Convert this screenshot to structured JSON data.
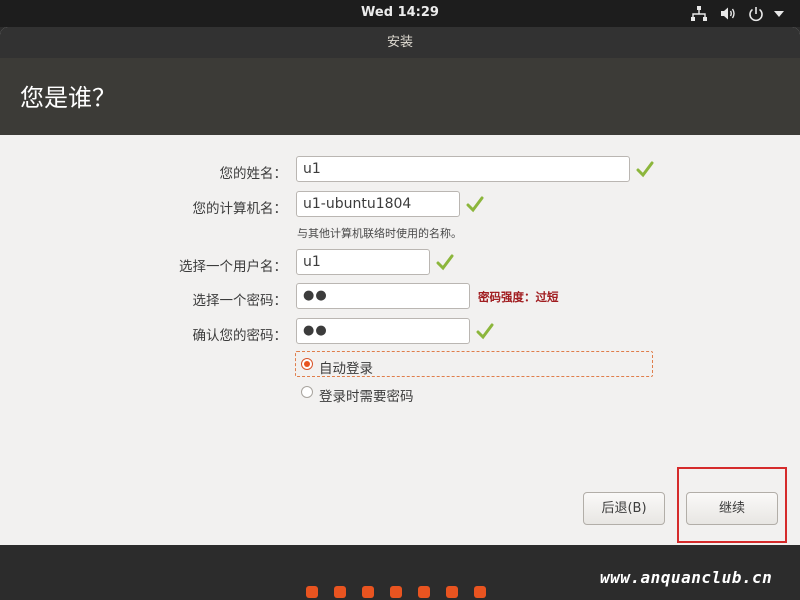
{
  "topbar": {
    "clock": "Wed 14:29",
    "icons": [
      "network-wired-icon",
      "volume-icon",
      "power-icon",
      "dropdown-arrow-icon"
    ]
  },
  "window": {
    "title": "安装",
    "page_title": "您是谁？"
  },
  "form": {
    "name": {
      "label": "您的姓名：",
      "value": "u1"
    },
    "computer_name": {
      "label": "您的计算机名：",
      "value": "u1-ubuntu1804",
      "hint": "与其他计算机联络时使用的名称。"
    },
    "username": {
      "label": "选择一个用户名：",
      "value": "u1"
    },
    "password": {
      "label": "选择一个密码：",
      "value": "●●",
      "strength": "密码强度：过短"
    },
    "confirm_password": {
      "label": "确认您的密码：",
      "value": "●●"
    },
    "login_options": [
      {
        "label": "自动登录",
        "selected": true
      },
      {
        "label": "登录时需要密码",
        "selected": false
      }
    ]
  },
  "buttons": {
    "back": "后退(B)",
    "continue": "继续"
  },
  "progress": {
    "steps_total": 7
  },
  "watermark": "www.anquanclub.cn",
  "colors": {
    "accent": "#e95420",
    "check": "#8cb63c",
    "warning_text": "#a11d20",
    "highlight": "#d52b2b"
  }
}
